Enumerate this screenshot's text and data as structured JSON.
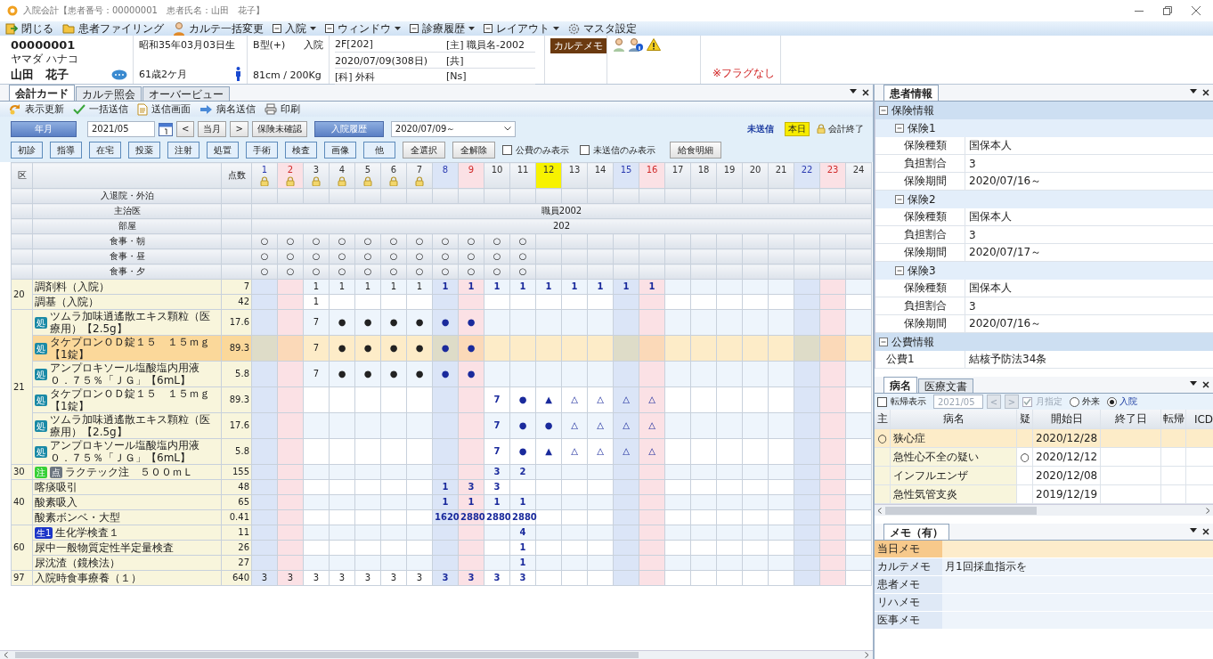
{
  "window": {
    "title": "入院会計【患者番号：00000001　患者氏名：山田　花子】"
  },
  "menu": [
    {
      "label": "閉じる",
      "kind": "exit"
    },
    {
      "label": "患者ファイリング",
      "kind": "folder"
    },
    {
      "label": "カルテ一括変更",
      "kind": "person"
    },
    {
      "label": "入院",
      "kind": "dropdown"
    },
    {
      "label": "ウィンドウ",
      "kind": "dropdown"
    },
    {
      "label": "診療履歴",
      "kind": "dropdown"
    },
    {
      "label": "レイアウト",
      "kind": "dropdown"
    },
    {
      "label": "マスタ設定",
      "kind": "gear"
    }
  ],
  "patient": {
    "id": "00000001",
    "kana": "ヤマダ ハナコ",
    "name": "山田　花子",
    "birth": "昭和35年03月03日生",
    "age": "61歳2ケ月",
    "blood": "B型(+)",
    "status": "入院",
    "body": "81cm / 200Kg",
    "ward": "2F[202]",
    "doctor": "[主] 職員名-2002",
    "admitted": "2020/07/09(308日)",
    "shared": "[共]",
    "dept": "[科] 外科",
    "nurse": "[Ns]",
    "memo_badge": "カルテメモ",
    "flag": "※フラグなし"
  },
  "left_tabs": [
    {
      "label": "会計カード",
      "selected": true
    },
    {
      "label": "カルテ照会",
      "selected": false
    },
    {
      "label": "オーバービュー",
      "selected": false
    }
  ],
  "toolbar": [
    {
      "label": "表示更新",
      "kind": "refresh"
    },
    {
      "label": "一括送信",
      "kind": "check"
    },
    {
      "label": "送信画面",
      "kind": "doc"
    },
    {
      "label": "病名送信",
      "kind": "arrow"
    },
    {
      "label": "印刷",
      "kind": "print"
    }
  ],
  "filter": {
    "period_button": "年月",
    "month": "2021/05",
    "prev": "<",
    "today_button": "当月",
    "next": ">",
    "insurance_button": "保険未確認",
    "history_button": "入院履歴",
    "admission": "2020/07/09～",
    "unsent": "未送信",
    "today_badge": "本日",
    "closed": "会計終了"
  },
  "categories": [
    {
      "label": "初診",
      "kind": "category"
    },
    {
      "label": "指導",
      "kind": "category"
    },
    {
      "label": "在宅",
      "kind": "category"
    },
    {
      "label": "投薬",
      "kind": "category"
    },
    {
      "label": "注射",
      "kind": "category"
    },
    {
      "label": "処置",
      "kind": "category"
    },
    {
      "label": "手術",
      "kind": "category"
    },
    {
      "label": "検査",
      "kind": "category"
    },
    {
      "label": "画像",
      "kind": "category"
    },
    {
      "label": "他",
      "kind": "category"
    },
    {
      "label": "全選択",
      "kind": "action"
    },
    {
      "label": "全解除",
      "kind": "action"
    }
  ],
  "options": [
    {
      "label": "公費のみ表示",
      "checked": false
    },
    {
      "label": "未送信のみ表示",
      "checked": false
    }
  ],
  "meal_button": "給食明細",
  "grid": {
    "section_header": "区",
    "points_header": "点数",
    "days": [
      {
        "label": "1",
        "kind": "sat",
        "locked": true,
        "today": false
      },
      {
        "label": "2",
        "kind": "sun",
        "locked": true,
        "today": false
      },
      {
        "label": "3",
        "kind": "weekday",
        "locked": true,
        "today": false
      },
      {
        "label": "4",
        "kind": "weekday",
        "locked": true,
        "today": false
      },
      {
        "label": "5",
        "kind": "weekday",
        "locked": true,
        "today": false
      },
      {
        "label": "6",
        "kind": "weekday",
        "locked": true,
        "today": false
      },
      {
        "label": "7",
        "kind": "weekday",
        "locked": true,
        "today": false
      },
      {
        "label": "8",
        "kind": "sat",
        "locked": false,
        "today": false
      },
      {
        "label": "9",
        "kind": "sun",
        "locked": false,
        "today": false
      },
      {
        "label": "10",
        "kind": "weekday",
        "locked": false,
        "today": false
      },
      {
        "label": "11",
        "kind": "weekday",
        "locked": false,
        "today": false
      },
      {
        "label": "12",
        "kind": "weekday",
        "locked": false,
        "today": true
      },
      {
        "label": "13",
        "kind": "weekday",
        "locked": false,
        "today": false
      },
      {
        "label": "14",
        "kind": "weekday",
        "locked": false,
        "today": false
      },
      {
        "label": "15",
        "kind": "sat",
        "locked": false,
        "today": false
      },
      {
        "label": "16",
        "kind": "sun",
        "locked": false,
        "today": false
      },
      {
        "label": "17",
        "kind": "weekday",
        "locked": false,
        "today": false
      },
      {
        "label": "18",
        "kind": "weekday",
        "locked": false,
        "today": false
      },
      {
        "label": "19",
        "kind": "weekday",
        "locked": false,
        "today": false
      },
      {
        "label": "20",
        "kind": "weekday",
        "locked": false,
        "today": false
      },
      {
        "label": "21",
        "kind": "weekday",
        "locked": false,
        "today": false
      },
      {
        "label": "22",
        "kind": "sat",
        "locked": false,
        "today": false
      },
      {
        "label": "23",
        "kind": "sun",
        "locked": false,
        "today": false
      },
      {
        "label": "24",
        "kind": "weekday",
        "locked": false,
        "today": false
      }
    ],
    "info_rows": [
      {
        "label": "入退院・外泊",
        "kind": "cells"
      },
      {
        "label": "主治医",
        "kind": "span",
        "value": "職員2002"
      },
      {
        "label": "部屋",
        "kind": "span",
        "value": "202"
      },
      {
        "label": "食事・朝",
        "kind": "cells",
        "cells": [
          "○",
          "○",
          "○",
          "○",
          "○",
          "○",
          "○",
          "○",
          "○",
          "○",
          "○"
        ]
      },
      {
        "label": "食事・昼",
        "kind": "cells",
        "cells": [
          "○",
          "○",
          "○",
          "○",
          "○",
          "○",
          "○",
          "○",
          "○",
          "○",
          "○"
        ]
      },
      {
        "label": "食事・夕",
        "kind": "cells",
        "cells": [
          "○",
          "○",
          "○",
          "○",
          "○",
          "○",
          "○",
          "○",
          "○",
          "○",
          "○"
        ]
      }
    ],
    "groups": [
      {
        "code": "20",
        "rows": [
          {
            "name": "調剤料（入院）",
            "points": "7",
            "selected": false,
            "cells": [
              null,
              null,
              "1",
              "1",
              "1",
              "1",
              "1",
              "1",
              "1",
              "1",
              "1",
              "1",
              "1",
              "1",
              "1",
              "1"
            ]
          },
          {
            "name": "調基（入院）",
            "points": "42",
            "selected": false,
            "cells": [
              null,
              null,
              "1"
            ]
          }
        ]
      },
      {
        "code": "21",
        "rows": [
          {
            "badges": [
              {
                "text": "処",
                "kind": "rx"
              }
            ],
            "name": "ツムラ加味逍遙散エキス顆粒（医療用）【2.5g】",
            "points": "17.6",
            "selected": false,
            "cells": [
              null,
              null,
              "7",
              "●",
              "●",
              "●",
              "●",
              "●",
              "●"
            ]
          },
          {
            "badges": [
              {
                "text": "処",
                "kind": "rx"
              }
            ],
            "name": "タケプロンＯＤ錠１５　１５ｍｇ【1錠】",
            "points": "89.3",
            "selected": true,
            "cells": [
              null,
              null,
              "7",
              "●",
              "●",
              "●",
              "●",
              "●",
              "●"
            ]
          },
          {
            "badges": [
              {
                "text": "処",
                "kind": "rx"
              }
            ],
            "name": "アンプロキソール塩酸塩内用液０．７５％「ＪＧ」【6mL】",
            "points": "5.8",
            "selected": false,
            "cells": [
              null,
              null,
              "7",
              "●",
              "●",
              "●",
              "●",
              "●",
              "●"
            ]
          },
          {
            "badges": [
              {
                "text": "処",
                "kind": "rx"
              }
            ],
            "name": "タケプロンＯＤ錠１５　１５ｍｇ【1錠】",
            "points": "89.3",
            "selected": false,
            "cells": [
              null,
              null,
              null,
              null,
              null,
              null,
              null,
              null,
              null,
              "7",
              "●",
              "▲",
              "△",
              "△",
              "△",
              "△"
            ]
          },
          {
            "badges": [
              {
                "text": "処",
                "kind": "rx"
              }
            ],
            "name": "ツムラ加味逍遙散エキス顆粒（医療用）【2.5g】",
            "points": "17.6",
            "selected": false,
            "cells": [
              null,
              null,
              null,
              null,
              null,
              null,
              null,
              null,
              null,
              "7",
              "●",
              "●",
              "△",
              "△",
              "△",
              "△"
            ]
          },
          {
            "badges": [
              {
                "text": "処",
                "kind": "rx"
              }
            ],
            "name": "アンプロキソール塩酸塩内用液０．７５％「ＪＧ」【6mL】",
            "points": "5.8",
            "selected": false,
            "cells": [
              null,
              null,
              null,
              null,
              null,
              null,
              null,
              null,
              null,
              "7",
              "●",
              "▲",
              "△",
              "△",
              "△",
              "△"
            ]
          }
        ]
      },
      {
        "code": "30",
        "rows": [
          {
            "badges": [
              {
                "text": "注",
                "kind": "injection"
              },
              {
                "text": "点",
                "kind": "drip"
              }
            ],
            "name": "ラクテック注　５００ｍＬ",
            "points": "155",
            "selected": false,
            "cells": [
              null,
              null,
              null,
              null,
              null,
              null,
              null,
              null,
              null,
              "3",
              "2"
            ]
          }
        ]
      },
      {
        "code": "40",
        "rows": [
          {
            "name": "喀痰吸引",
            "points": "48",
            "selected": false,
            "cells": [
              null,
              null,
              null,
              null,
              null,
              null,
              null,
              "1",
              "3",
              "3"
            ]
          },
          {
            "name": "酸素吸入",
            "points": "65",
            "selected": false,
            "cells": [
              null,
              null,
              null,
              null,
              null,
              null,
              null,
              "1",
              "1",
              "1",
              "1"
            ]
          },
          {
            "name": "酸素ボンベ・大型",
            "points": "0.41",
            "selected": false,
            "cells": [
              null,
              null,
              null,
              null,
              null,
              null,
              null,
              "1620",
              "2880",
              "2880",
              "2880"
            ]
          }
        ]
      },
      {
        "code": "60",
        "rows": [
          {
            "badges": [
              {
                "text": "生1",
                "kind": "lab"
              }
            ],
            "name": "生化学検査１",
            "points": "11",
            "selected": false,
            "cells": [
              null,
              null,
              null,
              null,
              null,
              null,
              null,
              null,
              null,
              null,
              "4"
            ]
          },
          {
            "name": "尿中一般物質定性半定量検査",
            "points": "26",
            "selected": false,
            "cells": [
              null,
              null,
              null,
              null,
              null,
              null,
              null,
              null,
              null,
              null,
              "1"
            ]
          },
          {
            "name": "尿沈渣（鏡検法）",
            "points": "27",
            "selected": false,
            "cells": [
              null,
              null,
              null,
              null,
              null,
              null,
              null,
              null,
              null,
              null,
              "1"
            ]
          }
        ]
      },
      {
        "code": "97",
        "rows": [
          {
            "name": "入院時食事療養（１）",
            "points": "640",
            "selected": false,
            "cells": [
              "3",
              "3",
              "3",
              "3",
              "3",
              "3",
              "3",
              "3",
              "3",
              "3",
              "3"
            ]
          }
        ]
      }
    ]
  },
  "patient_info": {
    "tab": "患者情報",
    "sections": [
      {
        "title": "保険情報",
        "expanded": true,
        "children": [
          {
            "title": "保険1",
            "expanded": true,
            "fields": [
              {
                "key": "保険種類",
                "value": "国保本人"
              },
              {
                "key": "負担割合",
                "value": "3"
              },
              {
                "key": "保険期間",
                "value": "2020/07/16～"
              }
            ]
          },
          {
            "title": "保険2",
            "expanded": true,
            "fields": [
              {
                "key": "保険種類",
                "value": "国保本人"
              },
              {
                "key": "負担割合",
                "value": "3"
              },
              {
                "key": "保険期間",
                "value": "2020/07/17～"
              }
            ]
          },
          {
            "title": "保険3",
            "expanded": true,
            "fields": [
              {
                "key": "保険種類",
                "value": "国保本人"
              },
              {
                "key": "負担割合",
                "value": "3"
              },
              {
                "key": "保険期間",
                "value": "2020/07/16～"
              }
            ]
          }
        ]
      },
      {
        "title": "公費情報",
        "expanded": true,
        "fields": [
          {
            "key": "公費1",
            "value": "結核予防法34条"
          }
        ]
      }
    ]
  },
  "disease": {
    "tabs": [
      {
        "label": "病名",
        "selected": true
      },
      {
        "label": "医療文書",
        "selected": false
      }
    ],
    "show_outcome": {
      "label": "転帰表示",
      "checked": false
    },
    "month_nav": {
      "month": "2021/05",
      "prev": "<",
      "next": ">",
      "disabled": true
    },
    "month_filter": {
      "label": "月指定",
      "checked": true,
      "disabled": true
    },
    "scope": [
      {
        "label": "外来",
        "selected": false
      },
      {
        "label": "入院",
        "selected": true
      }
    ],
    "columns": [
      "主",
      "病名",
      "疑",
      "開始日",
      "終了日",
      "転帰",
      "ICD"
    ],
    "rows": [
      {
        "main": "○",
        "name": "狭心症",
        "start": "2020/12/28",
        "selected": true
      },
      {
        "name": "急性心不全の疑い",
        "suspected": "○",
        "start": "2020/12/12",
        "selected": false
      },
      {
        "name": "インフルエンザ",
        "start": "2020/12/08",
        "selected": false
      },
      {
        "name": "急性気管支炎",
        "start": "2019/12/19",
        "selected": false
      }
    ]
  },
  "memo": {
    "tab": "メモ（有）",
    "rows": [
      {
        "label": "当日メモ",
        "selected": true
      },
      {
        "label": "カルテメモ",
        "value": "月1回採血指示を",
        "selected": false
      },
      {
        "label": "患者メモ",
        "selected": false
      },
      {
        "label": "リハメモ",
        "selected": false
      },
      {
        "label": "医事メモ",
        "selected": false
      }
    ]
  }
}
